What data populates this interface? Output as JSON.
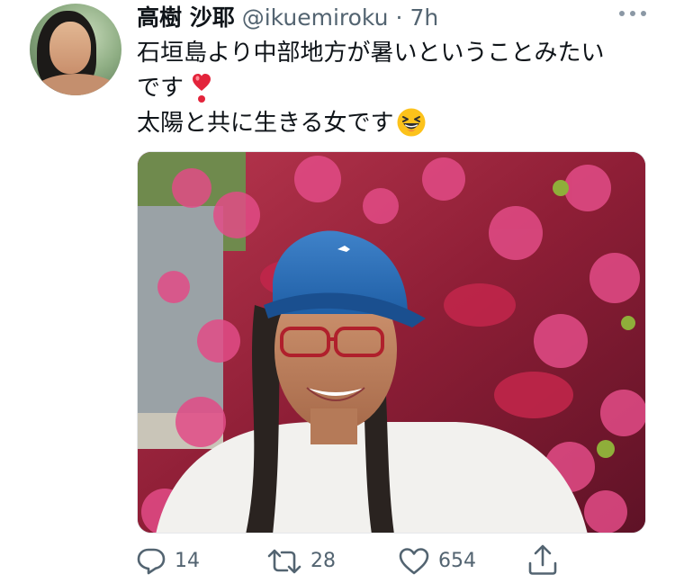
{
  "tweet": {
    "author_name": "高樹 沙耶",
    "handle": "@ikuemiroku",
    "separator": "·",
    "time": "7h",
    "text_lines": [
      "石垣島より中部地方が暑いということみたい",
      "です",
      "太陽と共に生きる女です"
    ],
    "emojis": [
      "heart-exclamation",
      "grinning-squinting-face"
    ],
    "photo_alt": "Smiling woman in a blue cap and red glasses in front of pink flowering bush"
  },
  "actions": {
    "replies": "14",
    "retweets": "28",
    "likes": "654"
  },
  "icons": [
    "more-icon",
    "reply-icon",
    "retweet-icon",
    "like-icon",
    "share-icon"
  ],
  "colors": {
    "text": "#0f1419",
    "secondary": "#536471",
    "border": "#e5e8eb"
  }
}
